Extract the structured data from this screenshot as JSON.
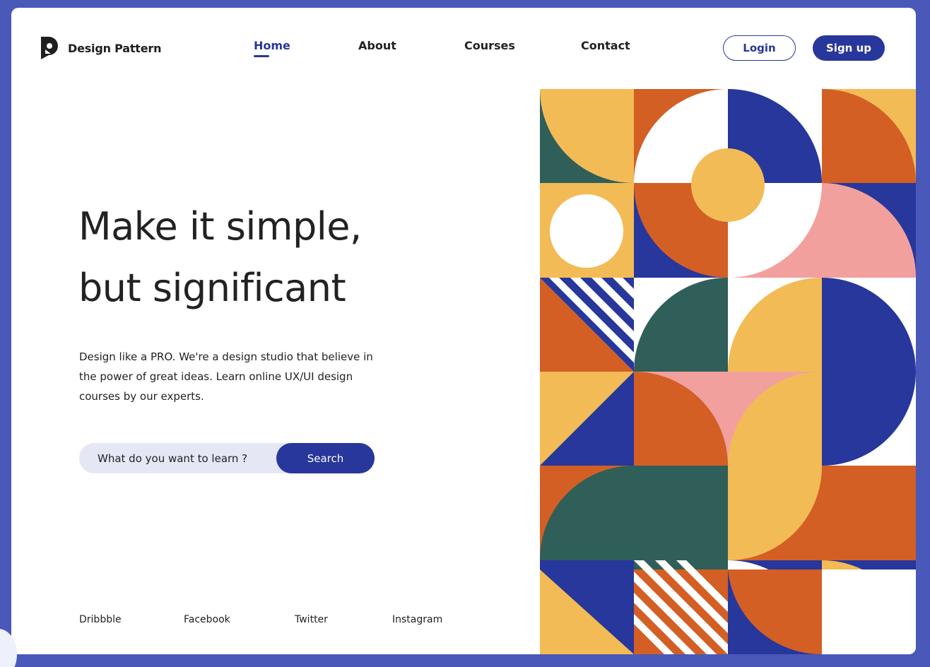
{
  "brand": {
    "name": "Design Pattern",
    "icon": "logo-mark-icon"
  },
  "nav": {
    "items": [
      {
        "label": "Home",
        "active": true
      },
      {
        "label": "About",
        "active": false
      },
      {
        "label": "Courses",
        "active": false
      },
      {
        "label": "Contact",
        "active": false
      }
    ]
  },
  "auth": {
    "login_label": "Login",
    "signup_label": "Sign up"
  },
  "hero": {
    "title_line1": "Make it simple,",
    "title_line2": "but significant",
    "description": "Design like a PRO. We're a design studio that believe in the power of great ideas. Learn online UX/UI design courses by our experts."
  },
  "search": {
    "placeholder": "What do you want to learn ?",
    "button_label": "Search"
  },
  "social": [
    "Dribbble",
    "Facebook",
    "Twitter",
    "Instagram"
  ],
  "colors": {
    "page_background": "#4958b9",
    "primary": "#27379b",
    "art_yellow": "#f3bb55",
    "art_orange": "#d35f25",
    "art_navy": "#27379b",
    "art_green": "#2f5f58",
    "art_pink": "#f2a09e",
    "art_white": "#ffffff"
  }
}
